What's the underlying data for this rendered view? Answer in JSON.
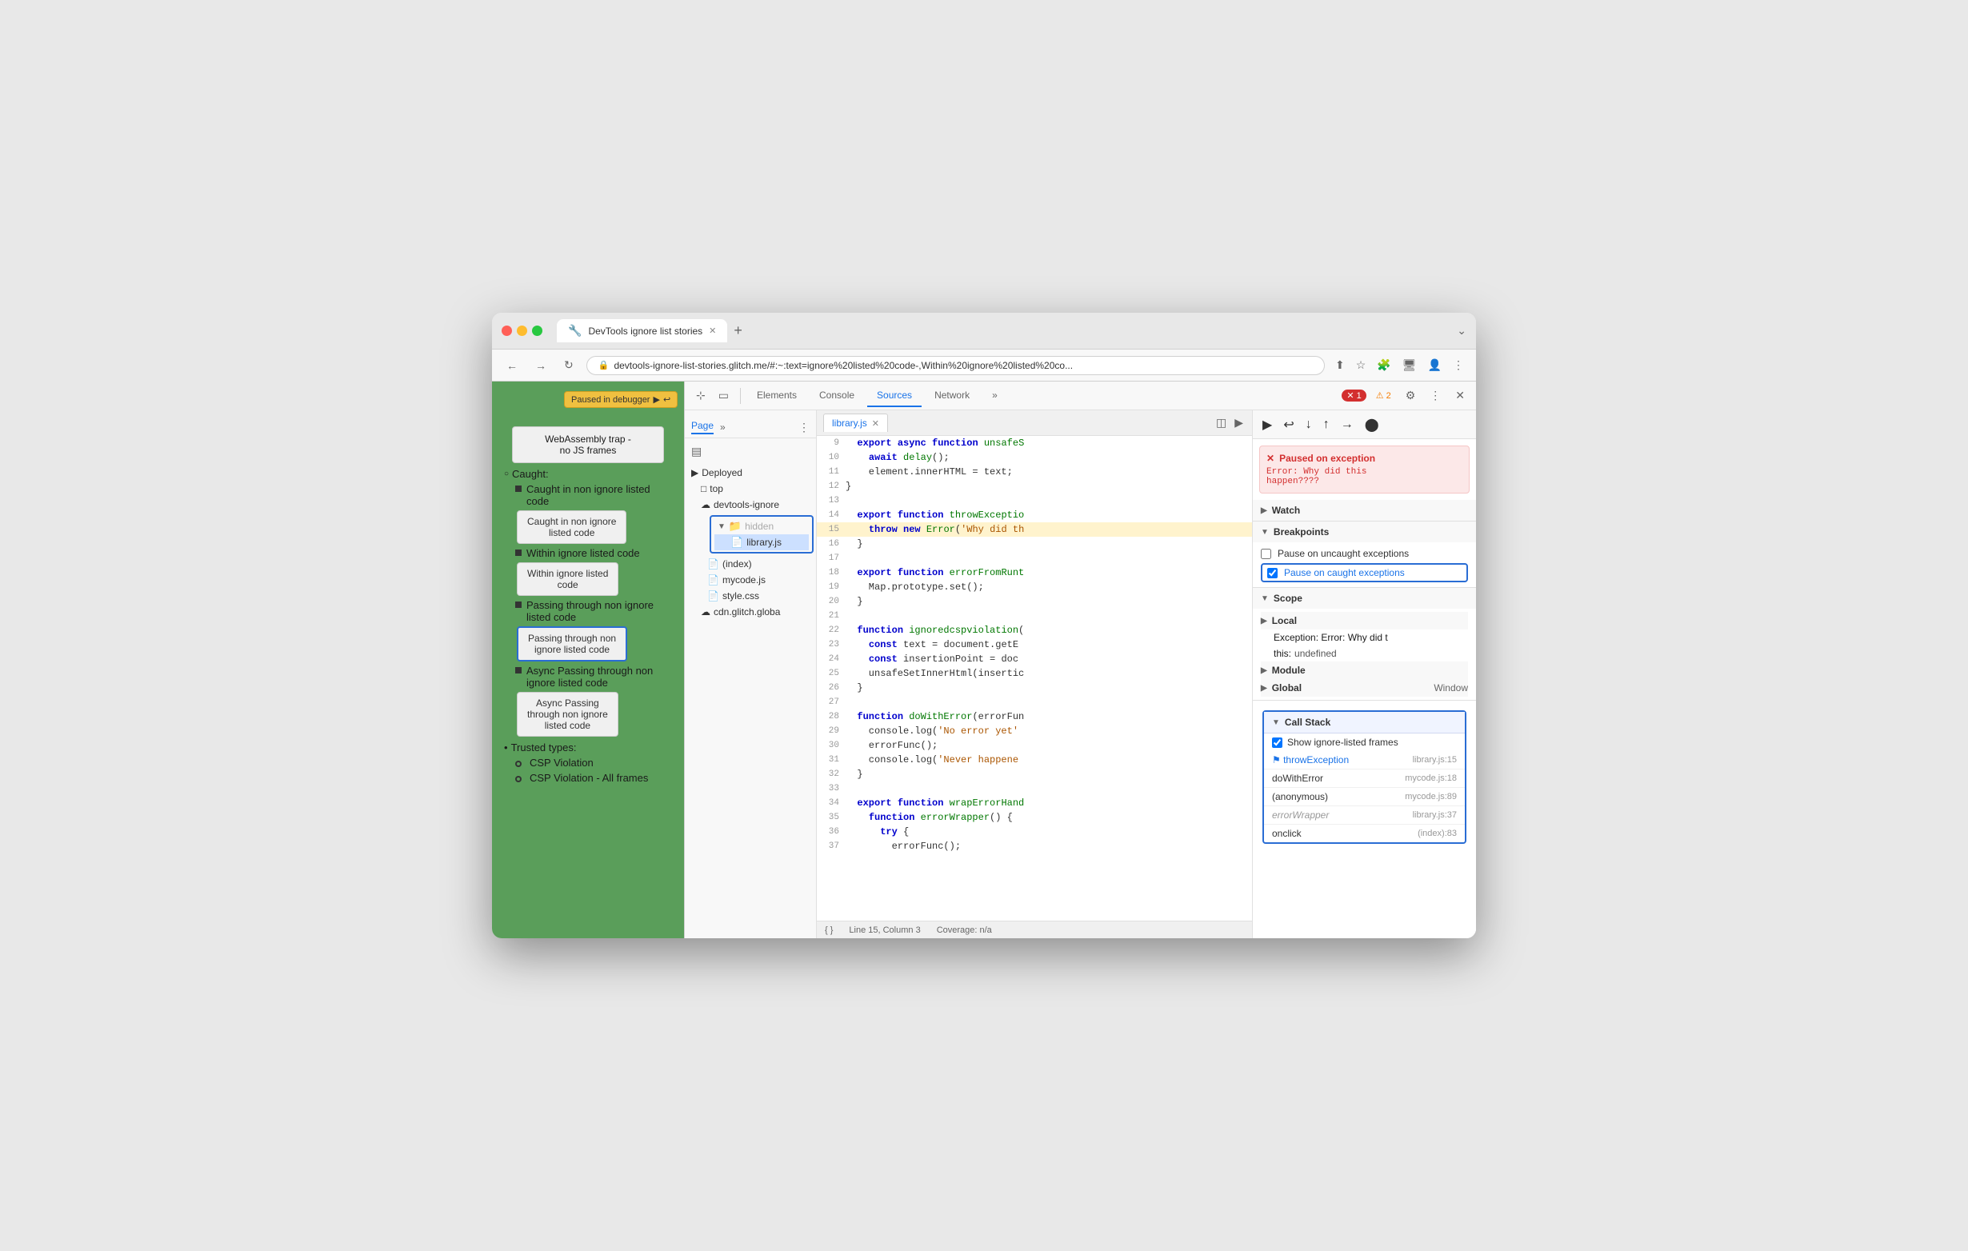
{
  "browser": {
    "tab_title": "DevTools ignore list stories",
    "url": "devtools-ignore-list-stories.glitch.me/#:~:text=ignore%20listed%20code-,Within%20ignore%20listed%20co...",
    "new_tab_label": "+",
    "overflow_label": "⌄"
  },
  "nav": {
    "back": "←",
    "forward": "→",
    "refresh": "↻"
  },
  "webpage": {
    "paused_label": "Paused in debugger",
    "webassembly_line1": "WebAssembly trap -",
    "webassembly_line2": "no JS frames",
    "caught_section": "Caught:",
    "caught_items": [
      {
        "label": "Caught in non ignore listed code",
        "button": "Caught in non ignore listed code"
      },
      {
        "label": "Within ignore listed code",
        "button": "Within ignore listed code"
      },
      {
        "label": "Passing through non ignore listed code",
        "button": "Passing through non ignore listed code",
        "highlighted": true
      },
      {
        "label": "Async Passing through non ignore listed code",
        "button": "Async Passing through non ignore listed code"
      }
    ],
    "trusted_types": "Trusted types:",
    "trusted_items": [
      "CSP Violation",
      "CSP Violation - All frames"
    ]
  },
  "devtools": {
    "tabs": [
      "Elements",
      "Console",
      "Sources",
      "Network"
    ],
    "active_tab": "Sources",
    "error_count": "1",
    "warning_count": "2",
    "toolbar_icons": [
      "inspect",
      "device",
      "more"
    ],
    "file_tree": {
      "deployed": "Deployed",
      "top": "top",
      "devtools_ignore": "devtools-ignore",
      "hidden": "hidden",
      "library_js": "library.js",
      "index": "(index)",
      "mycode_js": "mycode.js",
      "style_css": "style.css",
      "cdn_glitch": "cdn.glitch.globa"
    },
    "editor": {
      "filename": "library.js",
      "lines": [
        {
          "num": 9,
          "content": "  export async function unsafeS",
          "highlight": false
        },
        {
          "num": 10,
          "content": "    await delay();",
          "highlight": false
        },
        {
          "num": 11,
          "content": "    element.innerHTML = text;",
          "highlight": false
        },
        {
          "num": 12,
          "content": "}",
          "highlight": false
        },
        {
          "num": 13,
          "content": "",
          "highlight": false
        },
        {
          "num": 14,
          "content": "  export function throwExceptio",
          "highlight": false
        },
        {
          "num": 15,
          "content": "    throw new Error('Why did th",
          "highlight": true
        },
        {
          "num": 16,
          "content": "  }",
          "highlight": false
        },
        {
          "num": 17,
          "content": "",
          "highlight": false
        },
        {
          "num": 18,
          "content": "  export function errorFromRunt",
          "highlight": false
        },
        {
          "num": 19,
          "content": "    Map.prototype.set();",
          "highlight": false
        },
        {
          "num": 20,
          "content": "  }",
          "highlight": false
        },
        {
          "num": 21,
          "content": "",
          "highlight": false
        },
        {
          "num": 22,
          "content": "  function ignoredcspviolation(",
          "highlight": false
        },
        {
          "num": 23,
          "content": "    const text = document.getE",
          "highlight": false
        },
        {
          "num": 24,
          "content": "    const insertionPoint = doc",
          "highlight": false
        },
        {
          "num": 25,
          "content": "    unsafeSetInnerHtml(insertic",
          "highlight": false
        },
        {
          "num": 26,
          "content": "  }",
          "highlight": false
        },
        {
          "num": 27,
          "content": "",
          "highlight": false
        },
        {
          "num": 28,
          "content": "  function doWithError(errorFun",
          "highlight": false
        },
        {
          "num": 29,
          "content": "    console.log('No error yet'",
          "highlight": false
        },
        {
          "num": 30,
          "content": "    errorFunc();",
          "highlight": false
        },
        {
          "num": 31,
          "content": "    console.log('Never happene",
          "highlight": false
        },
        {
          "num": 32,
          "content": "  }",
          "highlight": false
        },
        {
          "num": 33,
          "content": "",
          "highlight": false
        },
        {
          "num": 34,
          "content": "  export function wrapErrorHand",
          "highlight": false
        },
        {
          "num": 35,
          "content": "    function errorWrapper() {",
          "highlight": false
        },
        {
          "num": 36,
          "content": "      try {",
          "highlight": false
        },
        {
          "num": 37,
          "content": "        errorFunc();",
          "highlight": false
        }
      ],
      "status": "Line 15, Column 3",
      "coverage": "Coverage: n/a"
    }
  },
  "debugger": {
    "toolbar_buttons": [
      "resume",
      "step-over",
      "step-into",
      "step-out",
      "step"
    ],
    "exception": {
      "title": "Paused on exception",
      "detail": "Error: Why did this\nhappen????"
    },
    "sections": {
      "watch": "Watch",
      "breakpoints": "Breakpoints",
      "pause_uncaught": "Pause on uncaught exceptions",
      "pause_caught": "Pause on caught exceptions",
      "scope": "Scope",
      "local": "Local",
      "local_exception": "Exception: Error: Why did t",
      "local_exception2": "this: undefined",
      "module": "Module",
      "global": "Global",
      "global_val": "Window"
    },
    "call_stack": {
      "header": "Call Stack",
      "show_ignored": "Show ignore-listed frames",
      "frames": [
        {
          "fn": "throwException",
          "loc": "library.js:15",
          "active": true,
          "muted": false
        },
        {
          "fn": "doWithError",
          "loc": "mycode.js:18",
          "active": false,
          "muted": false
        },
        {
          "fn": "(anonymous)",
          "loc": "mycode.js:89",
          "active": false,
          "muted": false
        },
        {
          "fn": "errorWrapper",
          "loc": "library.js:37",
          "active": false,
          "muted": true
        },
        {
          "fn": "onclick",
          "loc": "(index):83",
          "active": false,
          "muted": false
        }
      ]
    }
  },
  "colors": {
    "active_tab": "#1a73e8",
    "highlight_line": "#fff3cd",
    "error_red": "#d32f2f",
    "call_stack_border": "#2a6dd4",
    "page_green": "#5a9e5a"
  }
}
